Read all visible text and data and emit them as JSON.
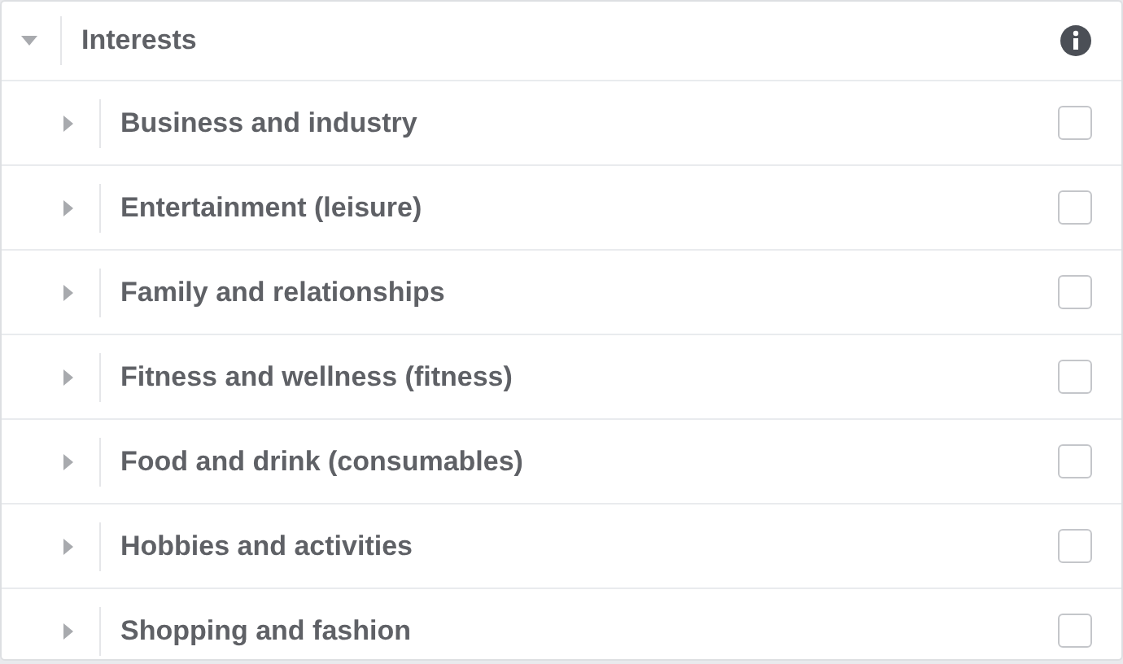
{
  "header": {
    "title": "Interests",
    "expanded": true
  },
  "items": [
    {
      "label": "Business and industry",
      "expanded": false,
      "checked": false
    },
    {
      "label": "Entertainment (leisure)",
      "expanded": false,
      "checked": false
    },
    {
      "label": "Family and relationships",
      "expanded": false,
      "checked": false
    },
    {
      "label": "Fitness and wellness (fitness)",
      "expanded": false,
      "checked": false
    },
    {
      "label": "Food and drink (consumables)",
      "expanded": false,
      "checked": false
    },
    {
      "label": "Hobbies and activities",
      "expanded": false,
      "checked": false
    },
    {
      "label": "Shopping and fashion",
      "expanded": false,
      "checked": false
    }
  ]
}
